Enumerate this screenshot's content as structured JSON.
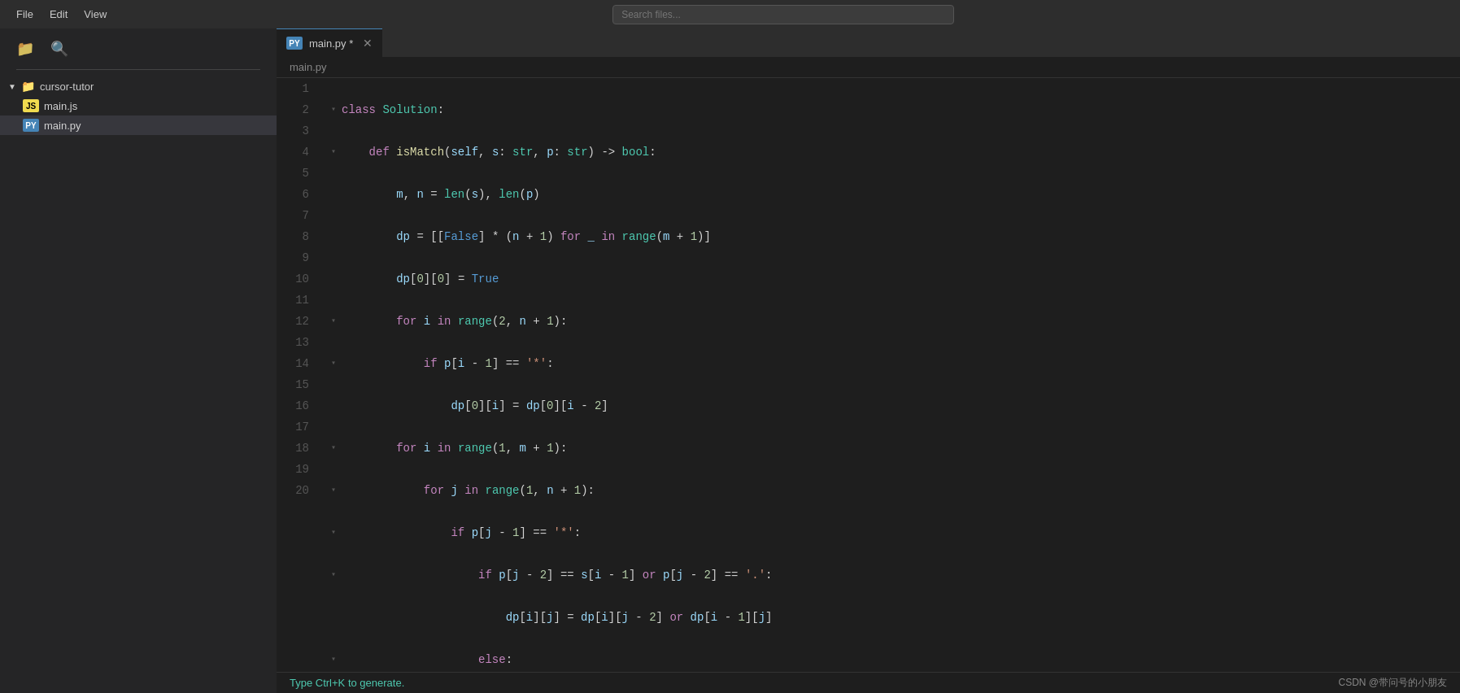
{
  "menubar": {
    "file_label": "File",
    "edit_label": "Edit",
    "view_label": "View"
  },
  "search": {
    "placeholder": "Search files..."
  },
  "sidebar": {
    "folder_name": "cursor-tutor",
    "files": [
      {
        "name": "main.js",
        "badge": "JS",
        "type": "js"
      },
      {
        "name": "main.py",
        "badge": "PY",
        "type": "py",
        "active": true
      }
    ]
  },
  "tab": {
    "badge": "PY",
    "filename": "main.py *",
    "breadcrumb": "main.py"
  },
  "lines": [
    {
      "num": 1,
      "foldable": true
    },
    {
      "num": 2,
      "foldable": true
    },
    {
      "num": 3,
      "foldable": false
    },
    {
      "num": 4,
      "foldable": false
    },
    {
      "num": 5,
      "foldable": false
    },
    {
      "num": 6,
      "foldable": true
    },
    {
      "num": 7,
      "foldable": true
    },
    {
      "num": 8,
      "foldable": false
    },
    {
      "num": 9,
      "foldable": true
    },
    {
      "num": 10,
      "foldable": true
    },
    {
      "num": 11,
      "foldable": true
    },
    {
      "num": 12,
      "foldable": true
    },
    {
      "num": 13,
      "foldable": false
    },
    {
      "num": 14,
      "foldable": true
    },
    {
      "num": 15,
      "foldable": false
    },
    {
      "num": 16,
      "foldable": true
    },
    {
      "num": 17,
      "foldable": true
    },
    {
      "num": 18,
      "foldable": false
    },
    {
      "num": 19,
      "foldable": false
    },
    {
      "num": 20,
      "foldable": false
    }
  ],
  "status": {
    "hint": "Type Ctrl+K to generate.",
    "attribution": "CSDN @带问号的小朋友"
  }
}
